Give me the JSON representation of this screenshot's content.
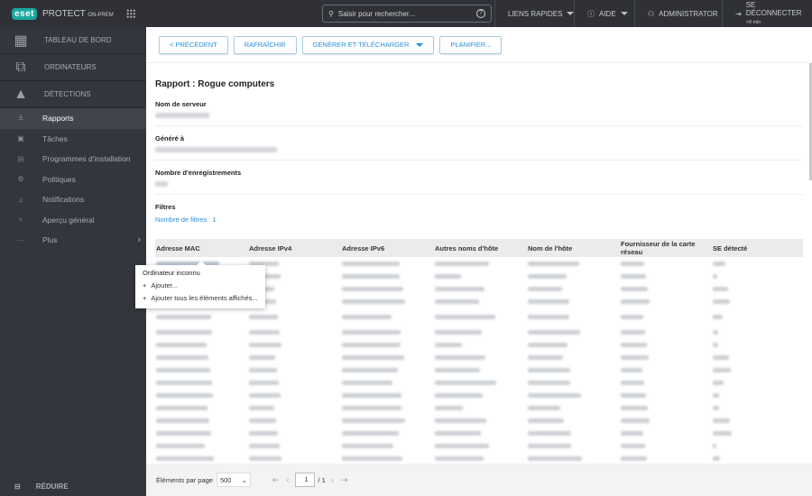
{
  "topbar": {
    "brand": "eset",
    "product": "PROTECT",
    "edition": "ON-PREM",
    "search_placeholder": "Saisir pour rechercher...",
    "quick_links": "LIENS RAPIDES",
    "help": "AIDE",
    "user": "ADMINISTRATOR",
    "logout": "SE DÉCONNECTER",
    "logout_timer": ">9 min"
  },
  "sidebar": {
    "main": [
      {
        "label": "TABLEAU DE BORD",
        "icon": "dashboard-icon"
      },
      {
        "label": "ORDINATEURS",
        "icon": "computers-icon"
      },
      {
        "label": "DÉTECTIONS",
        "icon": "warning-icon"
      }
    ],
    "items": [
      {
        "label": "Rapports",
        "icon": "reports-icon",
        "active": true
      },
      {
        "label": "Tâches",
        "icon": "tasks-icon"
      },
      {
        "label": "Programmes d'installation",
        "icon": "installers-icon"
      },
      {
        "label": "Politiques",
        "icon": "policies-icon"
      },
      {
        "label": "Notifications",
        "icon": "notifications-icon"
      },
      {
        "label": "Aperçu général",
        "icon": "status-overview-icon"
      },
      {
        "label": "Plus",
        "icon": "more-icon"
      }
    ],
    "collapse": "RÉDUIRE"
  },
  "toolbar": {
    "back": "< PRÉCÉDENT",
    "refresh": "RAFRAÎCHIR",
    "generate": "GÉNÉRER ET TÉLÉCHARGER",
    "schedule": "PLANIFIER..."
  },
  "report": {
    "title": "Rapport : Rogue computers",
    "server_label": "Nom de serveur",
    "generated_label": "Généré à",
    "records_label": "Nombre d'enregistrements",
    "filters_label": "Filtres",
    "filters_link": "Nombre de filtres : 1"
  },
  "table": {
    "columns": [
      "Adresse MAC",
      "Adresse IPv4",
      "Adresse IPv6",
      "Autres noms d'hôte",
      "Nom de l'hôte",
      "Fournisseur de la carte réseau",
      "SE détecté"
    ]
  },
  "context_menu": {
    "title": "Ordinateur inconnu",
    "items": [
      "Ajouter...",
      "Ajouter tous les éléments affichés..."
    ]
  },
  "footer": {
    "per_page_label": "Éléments par page",
    "per_page": "500",
    "page": "1",
    "total_pages": "/ 1"
  },
  "colors": {
    "accent": "#2b8fd6",
    "brand": "#1aa8a0",
    "sidebar": "#33363d"
  }
}
